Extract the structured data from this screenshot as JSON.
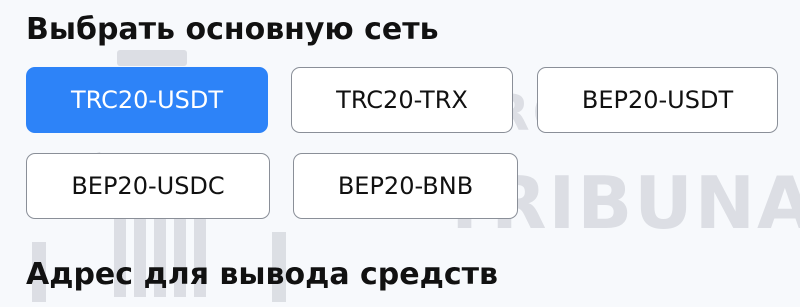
{
  "network_section": {
    "title": "Выбрать основную сеть",
    "options": [
      {
        "label": "TRC20-USDT",
        "selected": true
      },
      {
        "label": "TRC20-TRX",
        "selected": false
      },
      {
        "label": "BEP20-USDT",
        "selected": false
      },
      {
        "label": "BEP20-USDC",
        "selected": false
      },
      {
        "label": "BEP20-BNB",
        "selected": false
      }
    ]
  },
  "address_section": {
    "title": "Адрес для вывода средств"
  },
  "watermark": {
    "line1": "BROKER",
    "line2": "TRIBUNAL",
    "icon": "column-pillar-icon"
  },
  "colors": {
    "accent": "#2d83f8",
    "border": "#8a8f98",
    "background": "#f7f9fc"
  }
}
